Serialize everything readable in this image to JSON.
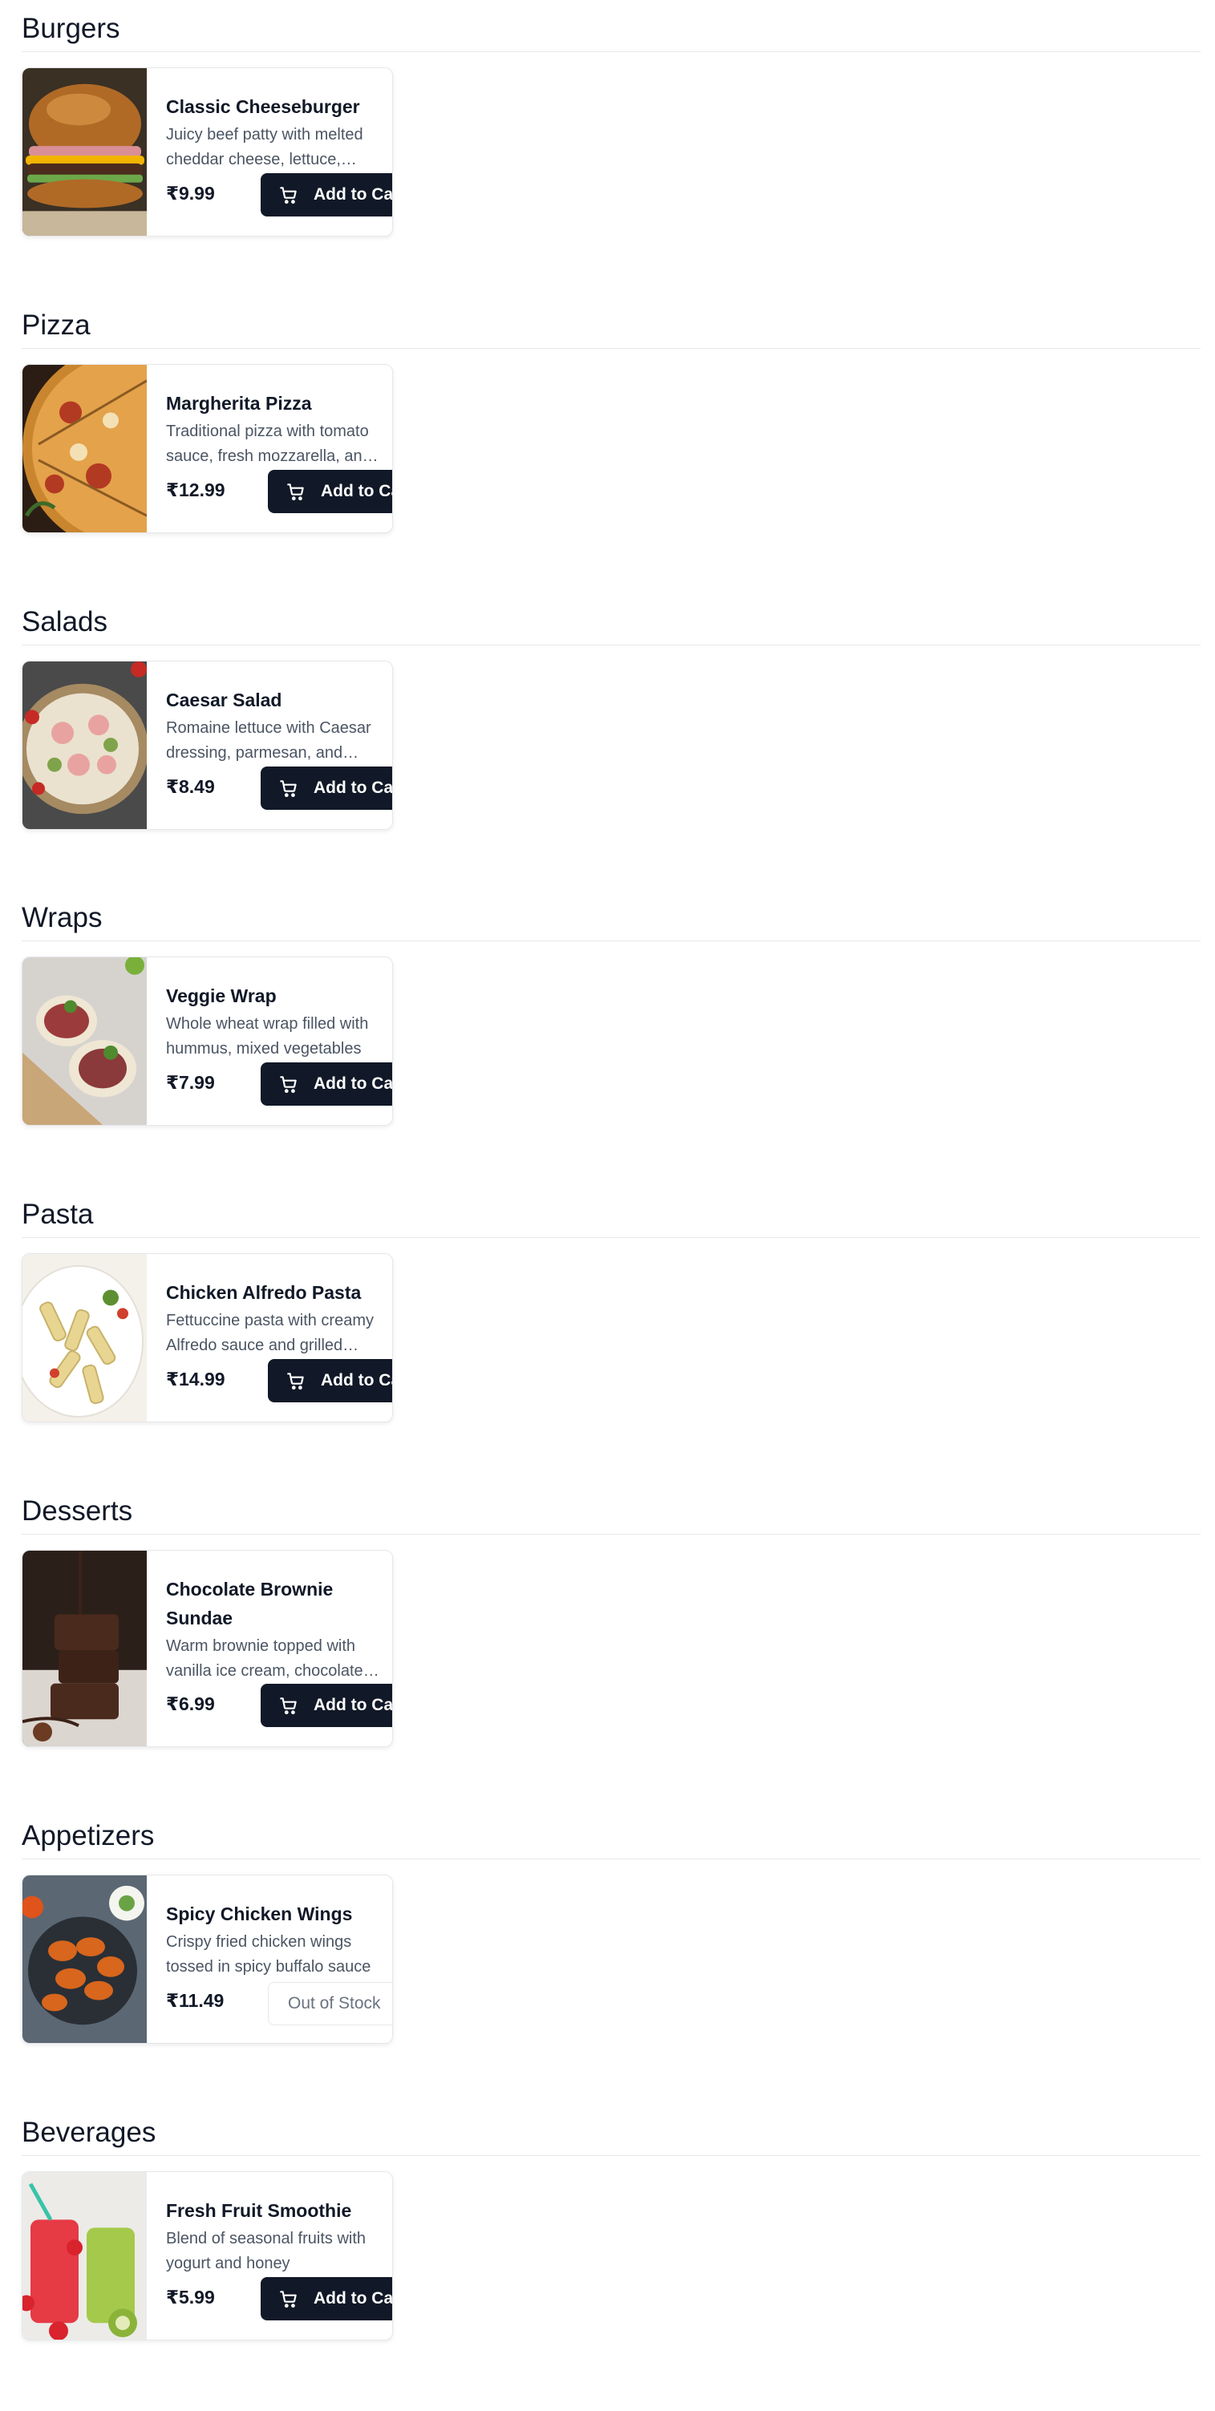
{
  "categories": [
    {
      "title": "Burgers",
      "item": {
        "name": "Classic Cheeseburger",
        "description": "Juicy beef patty with melted cheddar cheese, lettuce, tomato, and special sauce",
        "price": "₹9.99",
        "action": "Add to Cart",
        "in_stock": true
      }
    },
    {
      "title": "Pizza",
      "item": {
        "name": "Margherita Pizza",
        "description": "Traditional pizza with tomato sauce, fresh mozzarella, and basil",
        "price": "₹12.99",
        "action": "Add to Cart",
        "in_stock": true
      }
    },
    {
      "title": "Salads",
      "item": {
        "name": "Caesar Salad",
        "description": "Romaine lettuce with Caesar dressing, parmesan, and croutons",
        "price": "₹8.49",
        "action": "Add to Cart",
        "in_stock": true
      }
    },
    {
      "title": "Wraps",
      "item": {
        "name": "Veggie Wrap",
        "description": "Whole wheat wrap filled with hummus, mixed vegetables",
        "price": "₹7.99",
        "action": "Add to Cart",
        "in_stock": true
      }
    },
    {
      "title": "Pasta",
      "item": {
        "name": "Chicken Alfredo Pasta",
        "description": "Fettuccine pasta with creamy Alfredo sauce and grilled chicken",
        "price": "₹14.99",
        "action": "Add to Cart",
        "in_stock": true
      }
    },
    {
      "title": "Desserts",
      "item": {
        "name": "Chocolate Brownie Sundae",
        "description": "Warm brownie topped with vanilla ice cream, chocolate sauce",
        "price": "₹6.99",
        "action": "Add to Cart",
        "in_stock": true
      }
    },
    {
      "title": "Appetizers",
      "item": {
        "name": "Spicy Chicken Wings",
        "description": "Crispy fried chicken wings tossed in spicy buffalo sauce",
        "price": "₹11.49",
        "action": "Out of Stock",
        "in_stock": false
      }
    },
    {
      "title": "Beverages",
      "item": {
        "name": "Fresh Fruit Smoothie",
        "description": "Blend of seasonal fruits with yogurt and honey",
        "price": "₹5.99",
        "action": "Add to Cart",
        "in_stock": true
      }
    }
  ],
  "icons": {
    "cart": "shopping-cart-icon"
  },
  "colors": {
    "button_bg": "#111827",
    "button_text": "#ffffff",
    "disabled_text": "#6b7280"
  }
}
